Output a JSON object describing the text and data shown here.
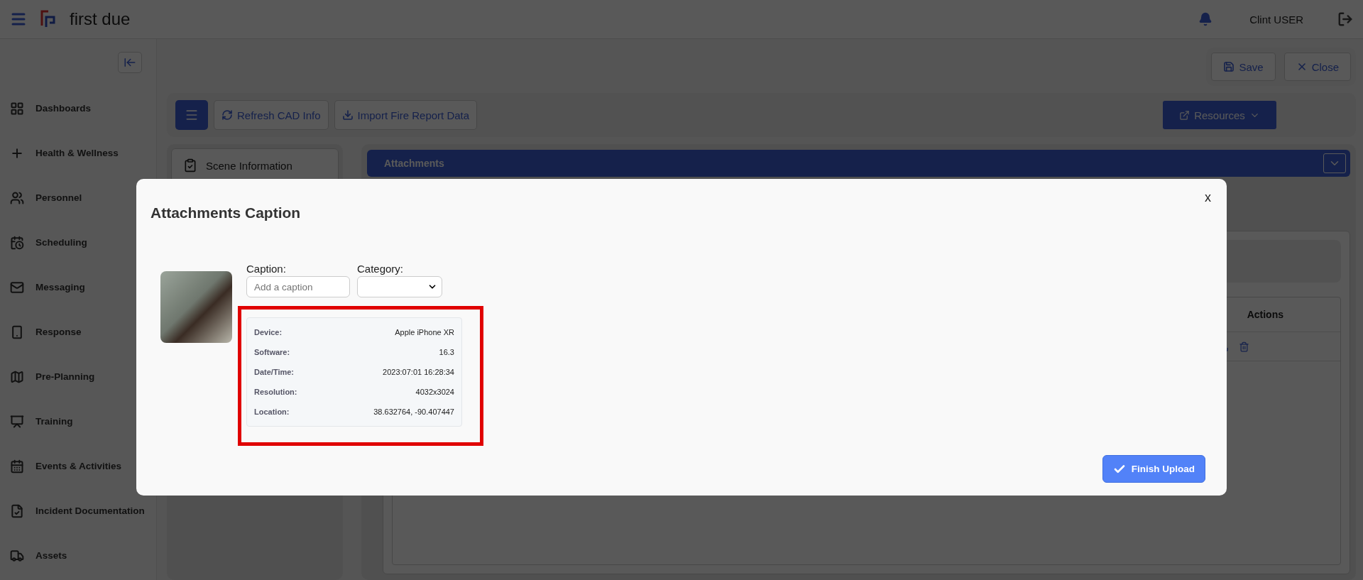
{
  "app": {
    "logo_text": "first due",
    "user_name": "Clint USER"
  },
  "sidebar": {
    "items": [
      {
        "label": "Dashboards",
        "kind": "dashboard"
      },
      {
        "label": "Health & Wellness",
        "kind": "plus"
      },
      {
        "label": "Personnel",
        "kind": "people"
      },
      {
        "label": "Scheduling",
        "kind": "schedule"
      },
      {
        "label": "Messaging",
        "kind": "mail"
      },
      {
        "label": "Response",
        "kind": "phone"
      },
      {
        "label": "Pre-Planning",
        "kind": "map"
      },
      {
        "label": "Training",
        "kind": "training"
      },
      {
        "label": "Events & Activities",
        "kind": "calendar"
      },
      {
        "label": "Incident Documentation",
        "kind": "document"
      },
      {
        "label": "Assets",
        "kind": "truck"
      }
    ]
  },
  "header_actions": [
    {
      "label": "Save",
      "kind": "save"
    },
    {
      "label": "Close",
      "kind": "close"
    }
  ],
  "toolbar": {
    "buttons": [
      {
        "label": "Refresh CAD Info",
        "kind": "refresh"
      },
      {
        "label": "Import Fire Report Data",
        "kind": "download"
      }
    ],
    "resources": "Resources"
  },
  "sections": [
    {
      "label": "Scene Information"
    }
  ],
  "panel": {
    "title": "Attachments",
    "table_header": "Actions"
  },
  "modal": {
    "title": "Attachments Caption",
    "close": "x",
    "caption_label": "Caption:",
    "caption_placeholder": "Add a caption",
    "category_label": "Category:",
    "metadata": [
      {
        "label": "Device:",
        "value": "Apple iPhone XR"
      },
      {
        "label": "Software:",
        "value": "16.3"
      },
      {
        "label": "Date/Time:",
        "value": "2023:07:01 16:28:34"
      },
      {
        "label": "Resolution:",
        "value": "4032x3024"
      },
      {
        "label": "Location:",
        "value": "38.632764, -90.407447"
      }
    ],
    "finish": "Finish Upload"
  }
}
